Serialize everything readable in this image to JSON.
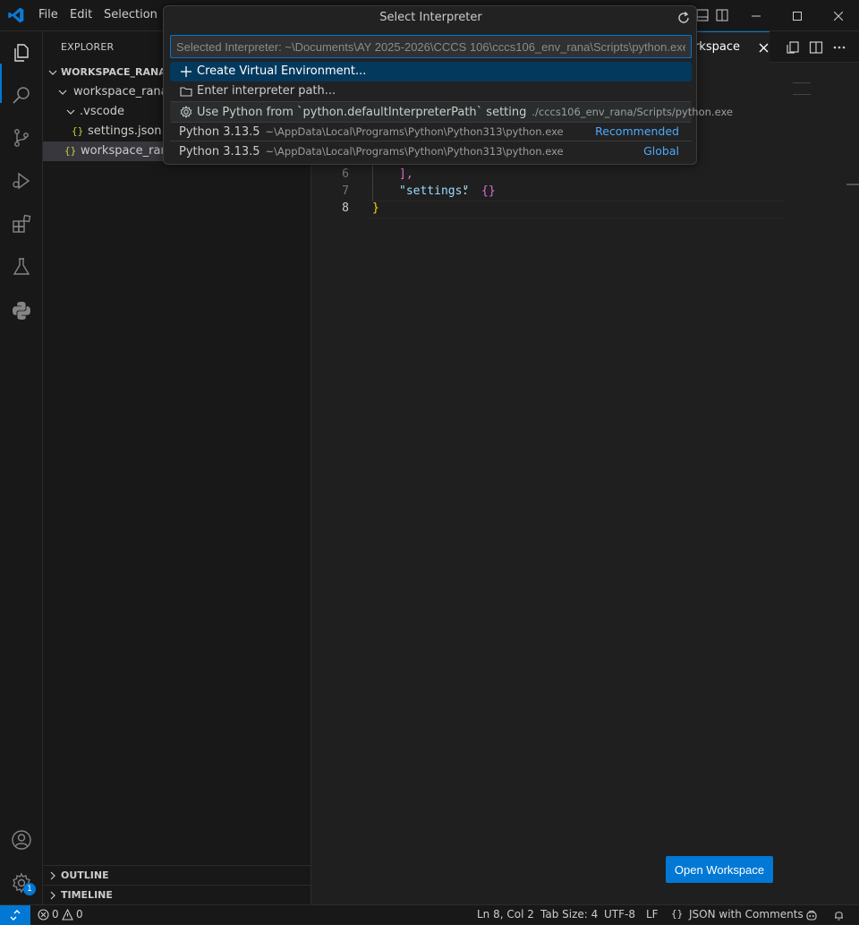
{
  "menu": [
    "File",
    "Edit",
    "Selection"
  ],
  "explorer": {
    "title": "EXPLORER",
    "workspace_header": "WORKSPACE_RANA (W",
    "items": [
      {
        "label": "workspace_rana"
      },
      {
        "label": ".vscode"
      },
      {
        "label": "settings.json",
        "icon_text": "{}"
      },
      {
        "label": "workspace_rana",
        "icon_text": "{}"
      }
    ],
    "outline": "OUTLINE",
    "timeline": "TIMELINE"
  },
  "editor": {
    "tab_label": "orkspace",
    "lines": [
      {
        "no": "6",
        "text_punct": "],"
      },
      {
        "no": "7",
        "key": "\"settings\"",
        "colon": ": ",
        "value": "{}"
      },
      {
        "no": "8",
        "text_punct": "}"
      }
    ],
    "open_workspace_button": "Open Workspace"
  },
  "quickpick": {
    "title": "Select Interpreter",
    "input_placeholder": "Selected Interpreter: ~\\Documents\\AY 2025-2026\\CCCS 106\\cccs106_env_rana\\Scripts\\python.exe",
    "items": [
      {
        "label": "Create Virtual Environment...",
        "icon": "plus-icon"
      },
      {
        "label": "Enter interpreter path...",
        "icon": "folder-icon"
      },
      {
        "label": "Use Python from `python.defaultInterpreterPath` setting",
        "desc": "./cccs106_env_rana/Scripts/python.exe",
        "icon": "gear-icon"
      },
      {
        "label": "Python 3.13.5",
        "desc": "~\\AppData\\Local\\Programs\\Python\\Python313\\python.exe",
        "tag": "Recommended"
      },
      {
        "label": "Python 3.13.5",
        "desc": "~\\AppData\\Local\\Programs\\Python\\Python313\\python.exe",
        "tag": "Global"
      }
    ]
  },
  "statusbar": {
    "errors": "0",
    "warnings": "0",
    "position": "Ln 8, Col 2",
    "tab_size": "Tab Size: 4",
    "encoding": "UTF-8",
    "eol": "LF",
    "language_icon": "{}",
    "language": "JSON with Comments",
    "accounts_badge": "1"
  },
  "colors": {
    "accent": "#0078d4",
    "json_key": "#9cdcfe",
    "bracket": "#da70d6",
    "bracket_gold": "#ffd700",
    "link_blue": "#4daafc"
  }
}
